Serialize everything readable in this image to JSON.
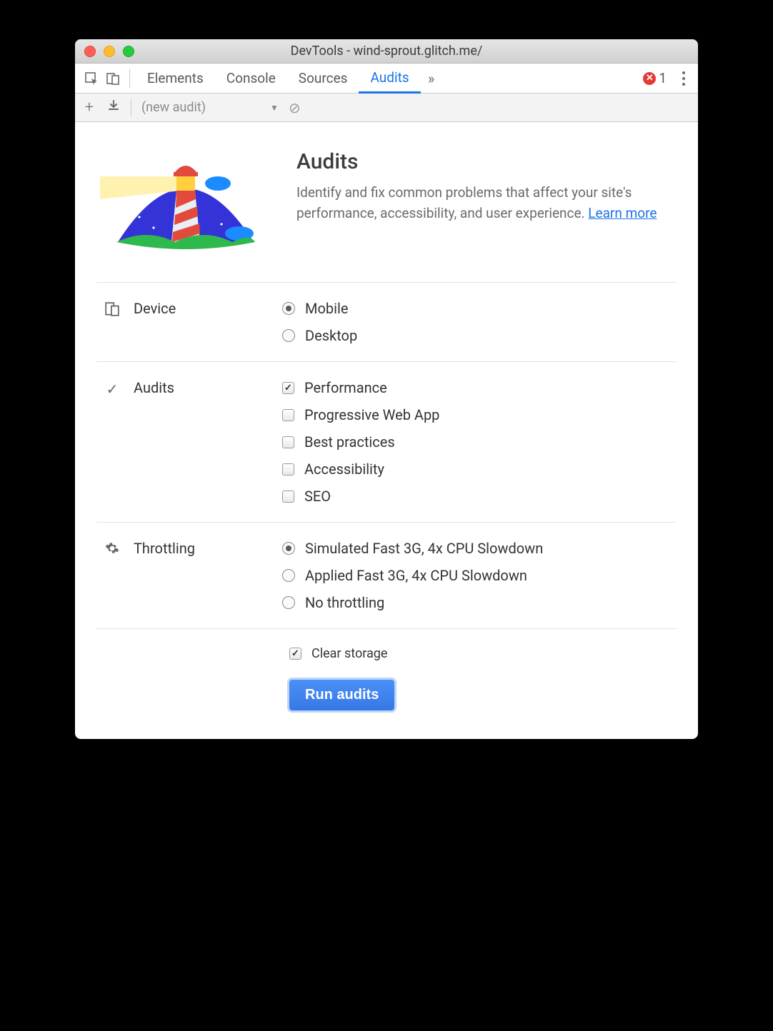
{
  "window": {
    "title": "DevTools - wind-sprout.glitch.me/"
  },
  "tabs": {
    "items": [
      "Elements",
      "Console",
      "Sources",
      "Audits"
    ],
    "active_index": 3,
    "error_count": "1"
  },
  "toolbar": {
    "dropdown_label": "(new audit)"
  },
  "hero": {
    "title": "Audits",
    "description_prefix": "Identify and fix common problems that affect your site's performance, accessibility, and user experience. ",
    "learn_more": "Learn more"
  },
  "device": {
    "section_label": "Device",
    "options": [
      "Mobile",
      "Desktop"
    ],
    "selected_index": 0
  },
  "audits": {
    "section_label": "Audits",
    "options": [
      {
        "label": "Performance",
        "checked": true
      },
      {
        "label": "Progressive Web App",
        "checked": false
      },
      {
        "label": "Best practices",
        "checked": false
      },
      {
        "label": "Accessibility",
        "checked": false
      },
      {
        "label": "SEO",
        "checked": false
      }
    ]
  },
  "throttling": {
    "section_label": "Throttling",
    "options": [
      "Simulated Fast 3G, 4x CPU Slowdown",
      "Applied Fast 3G, 4x CPU Slowdown",
      "No throttling"
    ],
    "selected_index": 0
  },
  "storage": {
    "clear_label": "Clear storage",
    "clear_checked": true
  },
  "run_button": "Run audits"
}
